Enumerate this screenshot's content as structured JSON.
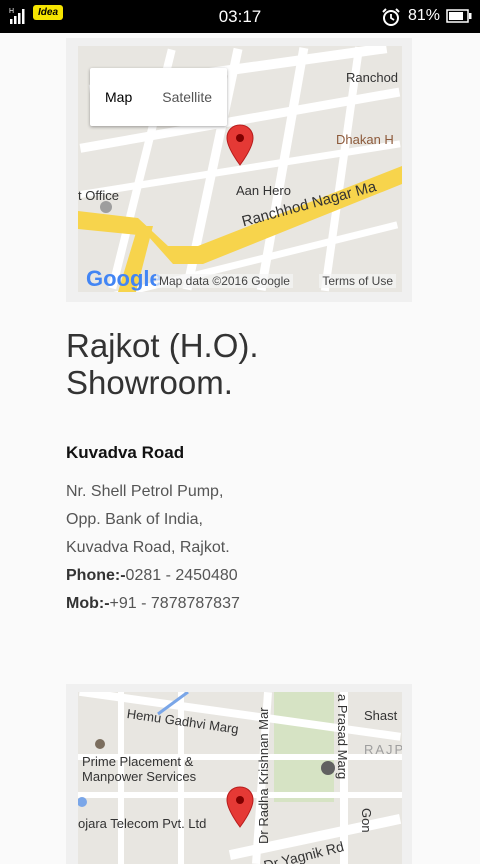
{
  "status_bar": {
    "carrier": "Idea",
    "time": "03:17",
    "battery_pct": "81%",
    "icons": [
      "signal-icon",
      "alarm-icon",
      "battery-icon"
    ]
  },
  "map1": {
    "type_map": "Map",
    "type_satellite": "Satellite",
    "labels": [
      "Ranchod",
      "Dhakan H",
      "t Office",
      "Aan Hero",
      "Ranchhod Nagar Ma"
    ],
    "google_logo": "Google",
    "map_data": "Map data ©2016 Google",
    "terms": "Terms of Use"
  },
  "location": {
    "title_line1": "Rajkot (H.O).",
    "title_line2": "Showroom.",
    "subtitle": "Kuvadva Road",
    "addr_line1": "Nr. Shell Petrol Pump,",
    "addr_line2": "Opp. Bank of India,",
    "addr_line3": "Kuvadva Road, Rajkot.",
    "phone_label": "Phone:-",
    "phone_value": "0281 - 2450480",
    "mob_label": "Mob:-",
    "mob_value": "+91 - 7878787837"
  },
  "map2": {
    "labels": [
      "Hemu Gadhvi Marg",
      "Dr Radha Krishnan Mar",
      "a Prasad Marg",
      "Shast",
      "RAJP",
      "Prime Placement &",
      "Manpower Services",
      "ojara Telecom Pvt. Ltd",
      "Dr Yagnik Rd",
      "Gon"
    ]
  },
  "colors": {
    "statusbar": "#000000",
    "carrier_badge": "#f5e400",
    "map_bg": "#e8e6e1",
    "major_road": "#f7d44c",
    "pin": "#e53935"
  }
}
